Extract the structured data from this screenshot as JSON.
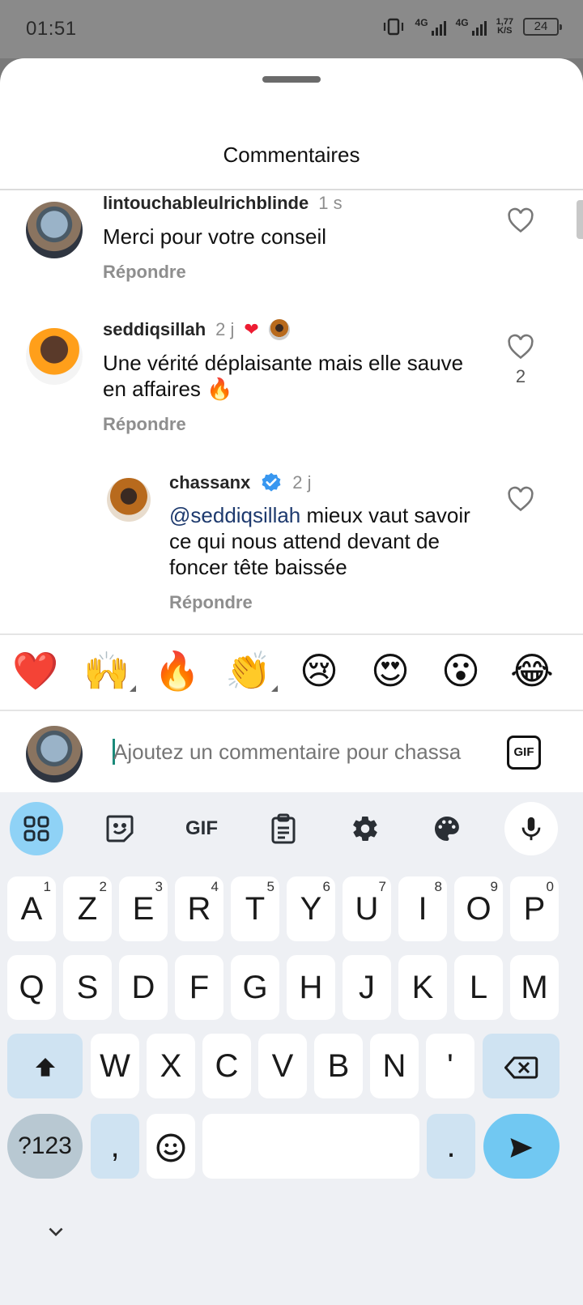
{
  "status_bar": {
    "time": "01:51",
    "network_1": "4G",
    "network_2": "4G",
    "speed_value": "1,77",
    "speed_unit": "K/S",
    "battery": "24"
  },
  "sheet": {
    "title": "Commentaires"
  },
  "comments": [
    {
      "author": "lintouchableulrichblinde",
      "time": "1 s",
      "text": "Merci pour votre conseil",
      "reply_label": "Répondre"
    },
    {
      "author": "seddiqsillah",
      "time": "2 j",
      "text": "Une vérité déplaisante mais elle sauve en affaires 🔥",
      "reply_label": "Répondre",
      "like_count": "2"
    },
    {
      "author": "chassanx",
      "time": "2 j",
      "mention": "@seddiqsillah",
      "text": " mieux vaut savoir ce qui nous attend devant de foncer tête baissée",
      "reply_label": "Répondre"
    }
  ],
  "emoji_bar": [
    "❤️",
    "🙌",
    "🔥",
    "👏",
    "😢",
    "😍",
    "😮",
    "😂"
  ],
  "composer": {
    "placeholder": "Ajoutez un commentaire pour chassa",
    "gif_label": "GIF"
  },
  "keyboard": {
    "toolbar": [
      "apps-grid-icon",
      "sticker-icon",
      "gif-icon",
      "clipboard-icon",
      "gear-icon",
      "palette-icon",
      "mic-icon"
    ],
    "toolbar_gif_label": "GIF",
    "row1": [
      {
        "k": "A",
        "n": "1"
      },
      {
        "k": "Z",
        "n": "2"
      },
      {
        "k": "E",
        "n": "3"
      },
      {
        "k": "R",
        "n": "4"
      },
      {
        "k": "T",
        "n": "5"
      },
      {
        "k": "Y",
        "n": "6"
      },
      {
        "k": "U",
        "n": "7"
      },
      {
        "k": "I",
        "n": "8"
      },
      {
        "k": "O",
        "n": "9"
      },
      {
        "k": "P",
        "n": "0"
      }
    ],
    "row2": [
      "Q",
      "S",
      "D",
      "F",
      "G",
      "H",
      "J",
      "K",
      "L",
      "M"
    ],
    "row3": [
      "W",
      "X",
      "C",
      "V",
      "B",
      "N",
      "'"
    ],
    "sym_label": "?123",
    "comma": ",",
    "period": "."
  }
}
